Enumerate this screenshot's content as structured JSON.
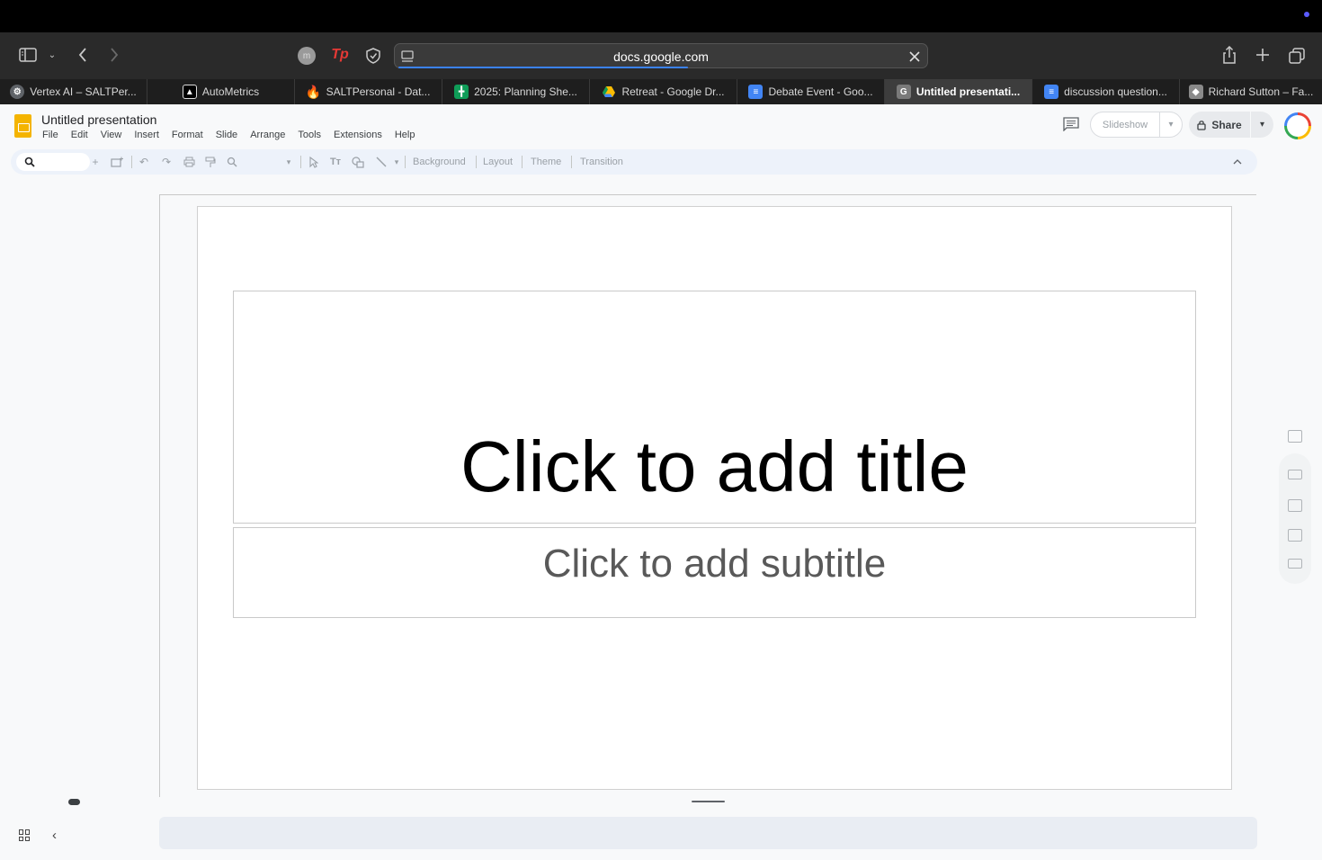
{
  "browser": {
    "url": "docs.google.com",
    "tabs": [
      {
        "title": "Vertex AI – SALTPer...",
        "icon": "vertex-ai-icon",
        "color": "#5f6368"
      },
      {
        "title": "AutoMetrics",
        "icon": "autometrics-icon",
        "color": "#000000"
      },
      {
        "title": "SALTPersonal - Dat...",
        "icon": "firebase-icon",
        "color": "#f57c00"
      },
      {
        "title": "2025: Planning She...",
        "icon": "sheets-icon",
        "color": "#0f9d58"
      },
      {
        "title": "Retreat - Google Dr...",
        "icon": "drive-icon",
        "color": "#4285f4"
      },
      {
        "title": "Debate Event - Goo...",
        "icon": "docs-icon",
        "color": "#4285f4"
      },
      {
        "title": "Untitled presentati...",
        "icon": "g-icon",
        "color": "#7a7a7a",
        "active": true
      },
      {
        "title": "discussion question...",
        "icon": "docs-icon",
        "color": "#4285f4"
      },
      {
        "title": "Richard Sutton – Fa...",
        "icon": "wolf-icon",
        "color": "#8a8a8a"
      }
    ]
  },
  "app": {
    "doc_title": "Untitled presentation",
    "menus": [
      "File",
      "Edit",
      "View",
      "Insert",
      "Format",
      "Slide",
      "Arrange",
      "Tools",
      "Extensions",
      "Help"
    ],
    "slideshow_label": "Slideshow",
    "share_label": "Share",
    "toolbar_text": {
      "background": "Background",
      "layout": "Layout",
      "theme": "Theme",
      "transition": "Transition"
    }
  },
  "slide": {
    "title_placeholder": "Click to add title",
    "subtitle_placeholder": "Click to add subtitle"
  },
  "colors": {
    "slides_brand": "#f4b400",
    "progress": "#3b82f6"
  }
}
